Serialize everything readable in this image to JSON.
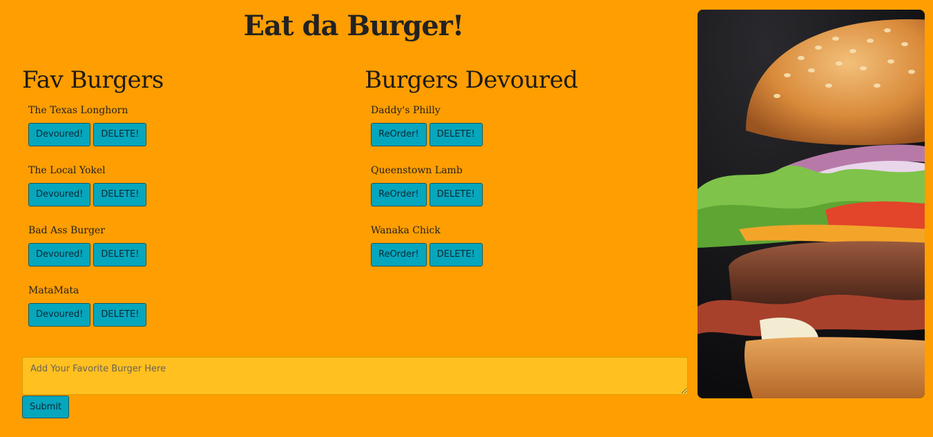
{
  "page": {
    "title": "Eat da Burger!"
  },
  "fav": {
    "heading": "Fav Burgers",
    "items": [
      {
        "name": "The Texas Longhorn",
        "primary": "Devoured!",
        "secondary": "DELETE!"
      },
      {
        "name": "The Local Yokel",
        "primary": "Devoured!",
        "secondary": "DELETE!"
      },
      {
        "name": "Bad Ass Burger",
        "primary": "Devoured!",
        "secondary": "DELETE!"
      },
      {
        "name": "MataMata",
        "primary": "Devoured!",
        "secondary": "DELETE!"
      }
    ]
  },
  "devoured": {
    "heading": "Burgers Devoured",
    "items": [
      {
        "name": "Daddy's Philly",
        "primary": "ReOrder!",
        "secondary": "DELETE!"
      },
      {
        "name": "Queenstown Lamb",
        "primary": "ReOrder!",
        "secondary": "DELETE!"
      },
      {
        "name": "Wanaka Chick",
        "primary": "ReOrder!",
        "secondary": "DELETE!"
      }
    ]
  },
  "form": {
    "placeholder": "Add Your Favorite Burger Here",
    "value": "",
    "submit_label": "Submit"
  },
  "colors": {
    "background": "#ff9e00",
    "button": "#06a6bd",
    "input": "#ffc020"
  },
  "photo": {
    "icon": "burger-photo"
  }
}
